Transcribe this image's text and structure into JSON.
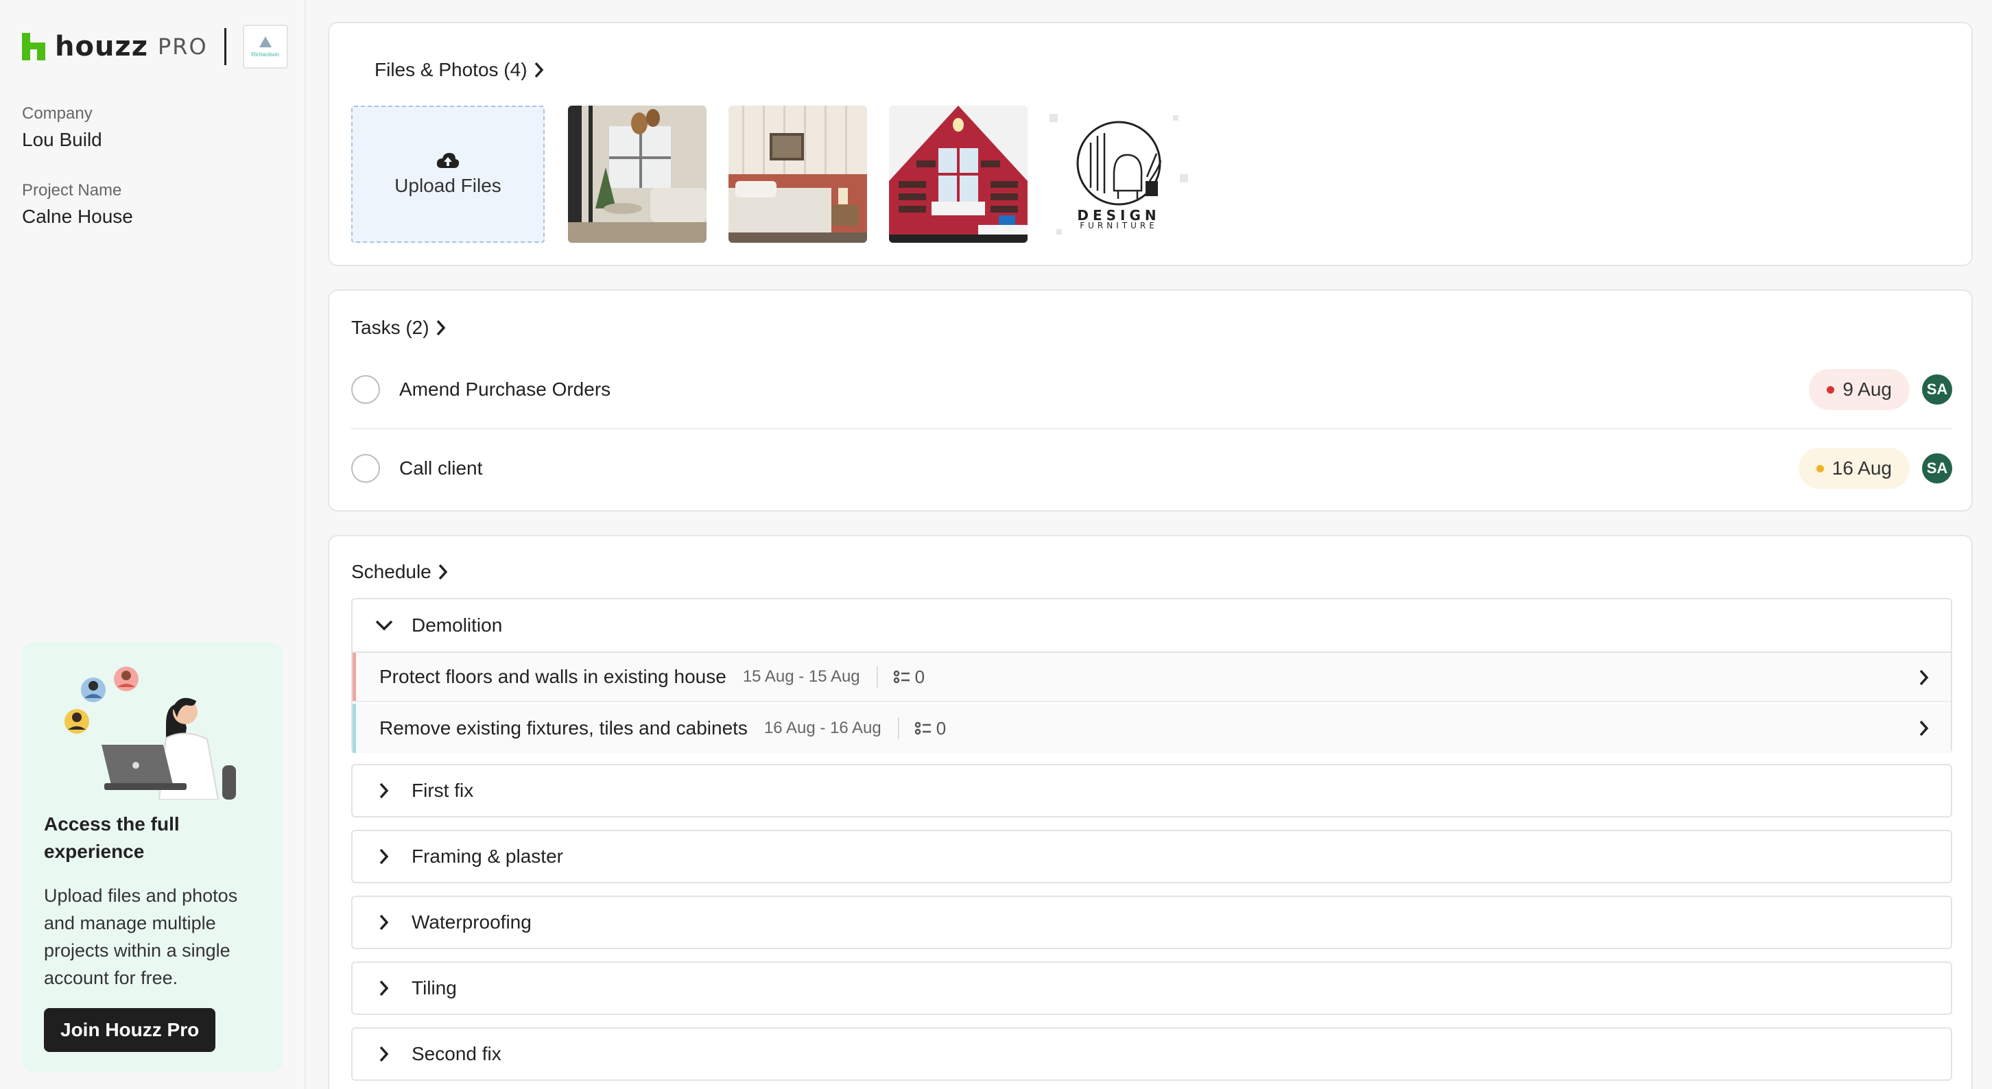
{
  "brand": {
    "word": "houzz",
    "pro": "PRO",
    "client_logo_text": "Richardson"
  },
  "sidebar": {
    "company_label": "Company",
    "company_value": "Lou Build",
    "project_label": "Project Name",
    "project_value": "Calne House",
    "promo": {
      "title": "Access the full experience",
      "body": "Upload files and photos and manage multiple projects within a single account for free.",
      "button": "Join Houzz Pro"
    }
  },
  "files": {
    "title": "Files & Photos (4)",
    "upload_label": "Upload Files",
    "logo_text_1": "DESIGN",
    "logo_text_2": "FURNITURE"
  },
  "tasks": {
    "title": "Tasks (2)",
    "items": [
      {
        "name": "Amend Purchase Orders",
        "date": "9 Aug",
        "assignee": "SA"
      },
      {
        "name": "Call client",
        "date": "16 Aug",
        "assignee": "SA"
      }
    ]
  },
  "schedule": {
    "title": "Schedule",
    "open_phase": {
      "name": "Demolition",
      "items": [
        {
          "name": "Protect floors and walls in existing house",
          "dates": "15 Aug - 15 Aug",
          "count": "0"
        },
        {
          "name": "Remove existing fixtures, tiles and cabinets",
          "dates": "16 Aug - 16 Aug",
          "count": "0"
        }
      ]
    },
    "phases": [
      "First fix",
      "Framing & plaster",
      "Waterproofing",
      "Tiling",
      "Second fix"
    ]
  },
  "colors": {
    "brand_green": "#4dbc15",
    "overdue_dot": "#d9342b",
    "overdue_bg": "#fbecea",
    "upcoming_dot": "#f2b227",
    "upcoming_bg": "#fdf5e4",
    "avatar_bg": "#23634a",
    "promo_bg": "#eaf8f2"
  }
}
